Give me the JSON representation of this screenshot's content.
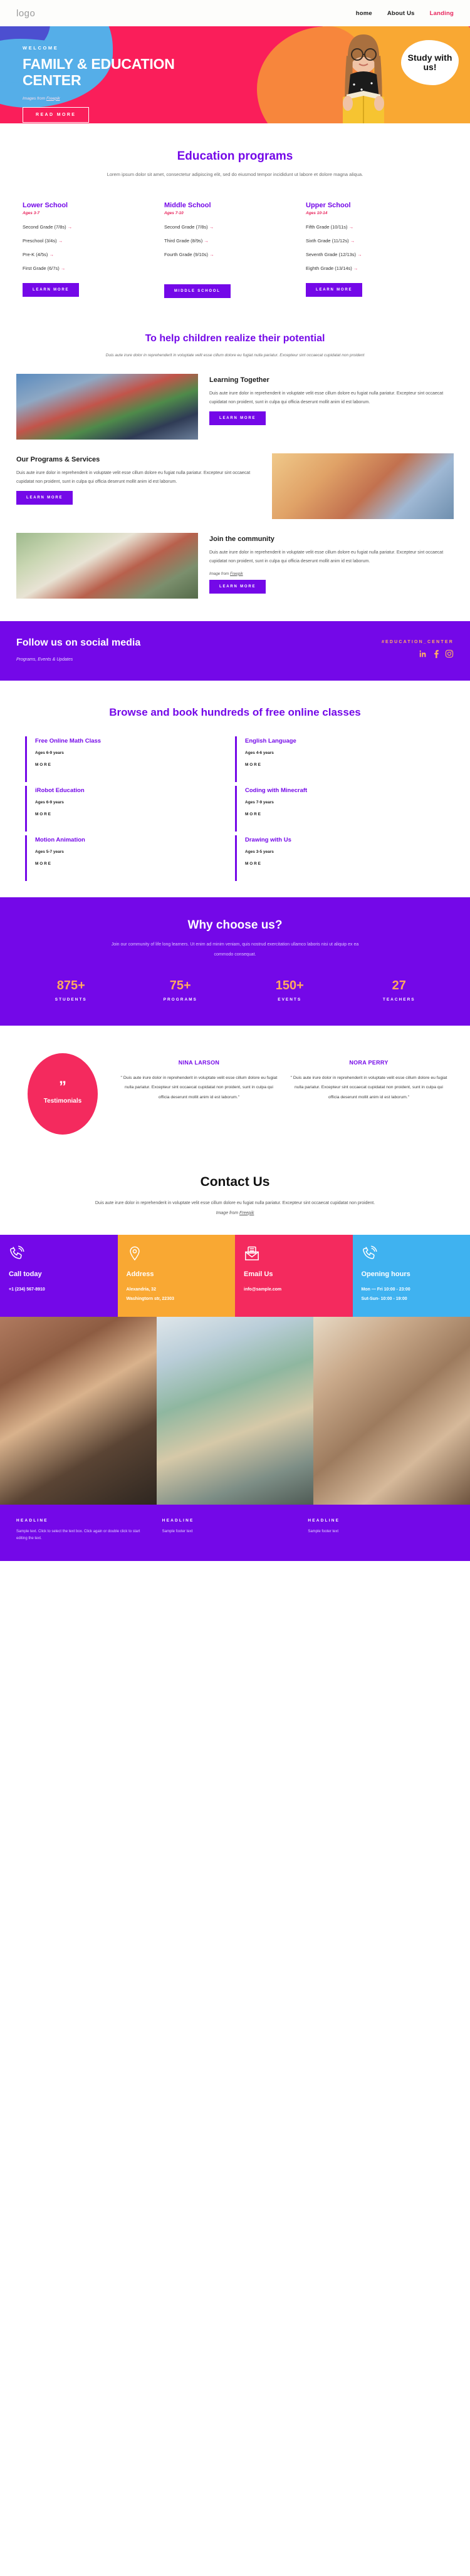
{
  "nav": {
    "logo": "logo",
    "links": [
      {
        "label": "home",
        "active": false
      },
      {
        "label": "About Us",
        "active": false
      },
      {
        "label": "Landing",
        "active": true
      }
    ]
  },
  "hero": {
    "eyebrow": "WELCOME",
    "title": "FAMILY & EDUCATION CENTER",
    "credit_prefix": "Images from ",
    "credit_link": "Freepik",
    "button": "READ MORE",
    "bubble": "Study with us!",
    "colors": {
      "pink": "#fa1e5a",
      "orange": "#f9a833",
      "orange_dark": "#f7863c",
      "blue": "#55aee8",
      "indigo": "#4c4fd0"
    }
  },
  "programs": {
    "title": "Education programs",
    "subtitle": "Lorem ipsum dolor sit amet, consectetur adipiscing elit, sed do eiusmod tempor incididunt ut labore et dolore magna aliqua.",
    "columns": [
      {
        "name": "Lower School",
        "ages": "Ages 3-7",
        "items": [
          "Second Grade (7/8s)",
          "Preschool (3/4s)",
          "Pre-K (4/5s)",
          "First Grade (6/7s)"
        ],
        "button": "LEARN MORE"
      },
      {
        "name": "Middle School",
        "ages": "Ages 7-10",
        "items": [
          "Second Grade (7/8s)",
          "Third Grade (8/9s)",
          "Fourth Grade (9/10s)"
        ],
        "button": "MIDDLE SCHOOL"
      },
      {
        "name": "Upper School",
        "ages": "Ages 10-14",
        "items": [
          "Fifth Grade (10/11s)",
          "Sixth Grade (11/12s)",
          "Seventh Grade (12/13s)",
          "Eighth Grade (13/14s)"
        ],
        "button": "LEARN MORE"
      }
    ]
  },
  "potential": {
    "title": "To help children realize their potential",
    "subtitle": "Duis aute irure dolor in reprehenderit in voluptate velit esse cillum dolore eu fugiat nulla pariatur. Excepteur sint occaecat cupidatat non proident",
    "features": [
      {
        "title": "Learning Together",
        "body": "Duis aute irure dolor in reprehenderit in voluptate velit esse cillum dolore eu fugiat nulla pariatur. Excepteur sint occaecat cupidatat non proident, sunt in culpa qui officia deserunt mollit anim id est laborum.",
        "button": "LEARN MORE",
        "credit_prefix": "",
        "credit_link": ""
      },
      {
        "title": "Our Programs & Services",
        "body": "Duis aute irure dolor in reprehenderit in voluptate velit esse cillum dolore eu fugiat nulla pariatur. Excepteur sint occaecat cupidatat non proident, sunt in culpa qui officia deserunt mollit anim id est laborum.",
        "button": "LEARN MORE",
        "credit_prefix": "",
        "credit_link": ""
      },
      {
        "title": "Join the community",
        "body": "Duis aute irure dolor in reprehenderit in voluptate velit esse cillum dolore eu fugiat nulla pariatur. Excepteur sint occaecat cupidatat non proident, sunt in culpa qui officia deserunt mollit anim id est laborum.",
        "button": "LEARN MORE",
        "credit_prefix": "Image from ",
        "credit_link": "Freepik"
      }
    ]
  },
  "social": {
    "title": "Follow us on social media",
    "subtitle": "Programs, Events & Updates",
    "hashtag": "#EDUCATION_CENTER",
    "icons": [
      "linkedin-icon",
      "facebook-icon",
      "instagram-icon"
    ],
    "accent": "#ffb063"
  },
  "classes": {
    "title": "Browse and book hundreds of free online classes",
    "more_label": "MORE",
    "items": [
      {
        "name": "Free Online Math Class",
        "ages": "Ages 6-9 years"
      },
      {
        "name": "English Language",
        "ages": "Ages 4-6 years"
      },
      {
        "name": "iRobot Education",
        "ages": "Ages 6-9 years"
      },
      {
        "name": "Coding with Minecraft",
        "ages": "Ages 7-9 years"
      },
      {
        "name": "Motion Animation",
        "ages": "Ages 5-7 years"
      },
      {
        "name": "Drawing with Us",
        "ages": "Ages 3-5 years"
      }
    ]
  },
  "why": {
    "title": "Why choose us?",
    "subtitle": "Join our community of life long learners. Ut enim ad minim veniam, quis nostrud exercitation ullamco laboris nisi ut aliquip ex ea commodo consequat.",
    "stats": [
      {
        "value": "875+",
        "label": "STUDENTS"
      },
      {
        "value": "75+",
        "label": "PROGRAMS"
      },
      {
        "value": "150+",
        "label": "EVENTS"
      },
      {
        "value": "27",
        "label": "TEACHERS"
      }
    ],
    "accent": "#ffa95e"
  },
  "testimonials": {
    "badge_label": "Testimonials",
    "quote_glyph": "”",
    "items": [
      {
        "name": "NINA LARSON",
        "body": "\" Duis aute irure dolor in reprehenderit in voluptate velit esse cillum dolore eu fugiat nulla pariatur. Excepteur sint occaecat cupidatat non proident, sunt in culpa qui officia deserunt mollit anim id est laborum.\""
      },
      {
        "name": "NORA PERRY",
        "body": "\" Duis aute irure dolor in reprehenderit in voluptate velit esse cillum dolore eu fugiat nulla pariatur. Excepteur sint occaecat cupidatat non proident, sunt in culpa qui officia deserunt mollit anim id est laborum.\""
      }
    ]
  },
  "contact": {
    "title": "Contact Us",
    "subtitle_main": "Duis aute irure dolor in reprehenderit in voluptate velit esse cillum dolore eu fugiat nulla pariatur. Excepteur sint occaecat cupidatat non proident. ",
    "credit_prefix": "Image from ",
    "credit_link": "Freepik",
    "cards": [
      {
        "icon": "phone-icon",
        "title": "Call today",
        "lines": [
          "+1 (234) 567-8910"
        ],
        "color": "#7408e8"
      },
      {
        "icon": "location-pin-icon",
        "title": "Address",
        "lines": [
          "Alexandria, 32",
          "Washingtorn str, 22303"
        ],
        "color": "#f9a833"
      },
      {
        "icon": "envelope-icon",
        "title": "Email Us",
        "lines": [
          "info@sample.com"
        ],
        "color": "#f42a5e"
      },
      {
        "icon": "phone-icon",
        "title": "Opening hours",
        "lines": [
          "Mon — Fri 10:00 - 23:00",
          "Sut-Sun- 10:00 - 19:00"
        ],
        "color": "#3fb2f0"
      }
    ]
  },
  "footer": {
    "columns": [
      {
        "head": "HEADLINE",
        "body": "Sample text. Click to select the text box. Click again or double click to start editing the text."
      },
      {
        "head": "HEADLINE",
        "body": "Sample footer text"
      },
      {
        "head": "HEADLINE",
        "body": "Sample footer text"
      }
    ]
  }
}
